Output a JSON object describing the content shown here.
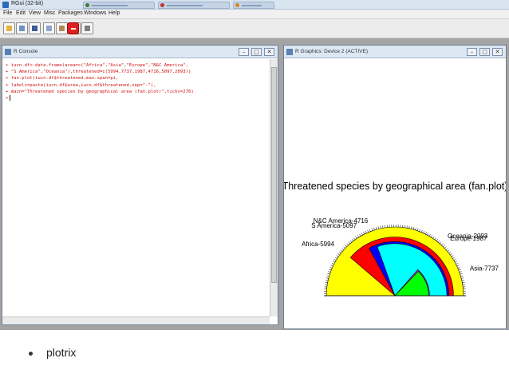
{
  "app": {
    "title": "RGui (32-bit)"
  },
  "menu": [
    "File",
    "Edit",
    "View",
    "Misc",
    "Packages",
    "Windows",
    "Help"
  ],
  "toolbar_icons": [
    "open-script-icon",
    "load-workspace-icon",
    "save-workspace-icon",
    "copy-icon",
    "paste-icon",
    "copy-paste-icon",
    "stop-icon",
    "print-icon"
  ],
  "console": {
    "title": "R Console",
    "lines": [
      "> iucn.df<-data.frame(area=c(\"Africa\",\"Asia\",\"Europe\",\"N&C America\",",
      "+ \"S America\",\"Oceania\"),threatened=c(5994,7737,1987,4716,5097,2093))",
      "> fan.plot(iucn.df$threatened,max.span=pi,",
      "+ labels=paste(iucn.df$area,iucn.df$threatened,sep=\"-\"),",
      "+ main=\"Threatened species by geographical area (fan.plot)\",ticks=276)"
    ],
    "prompt": ">"
  },
  "graphics": {
    "title": "R Graphics: Device 2 (ACTIVE)"
  },
  "chart_data": {
    "type": "pie",
    "title": "Threatened species by geographical area (fan.plot)",
    "categories": [
      "Africa",
      "Asia",
      "Europe",
      "N&C America",
      "S America",
      "Oceania"
    ],
    "values": [
      5994,
      7737,
      1987,
      4716,
      5097,
      2093
    ],
    "labels": [
      "Africa-5994",
      "Asia-7737",
      "Europe-1987",
      "N&C America-4716",
      "S America-5097",
      "Oceania-2093"
    ],
    "colors": {
      "Asia": "#ffff00",
      "Africa": "#ff0000",
      "S America": "#0000ff",
      "N&C America": "#00ffff",
      "Oceania": "#cc33cc",
      "Europe": "#00ff00"
    },
    "max_span": "pi",
    "ticks": 276
  },
  "bullet": {
    "text": "plotrix"
  },
  "window_buttons": {
    "minimize": "–",
    "restore": "□",
    "close": "✕"
  }
}
